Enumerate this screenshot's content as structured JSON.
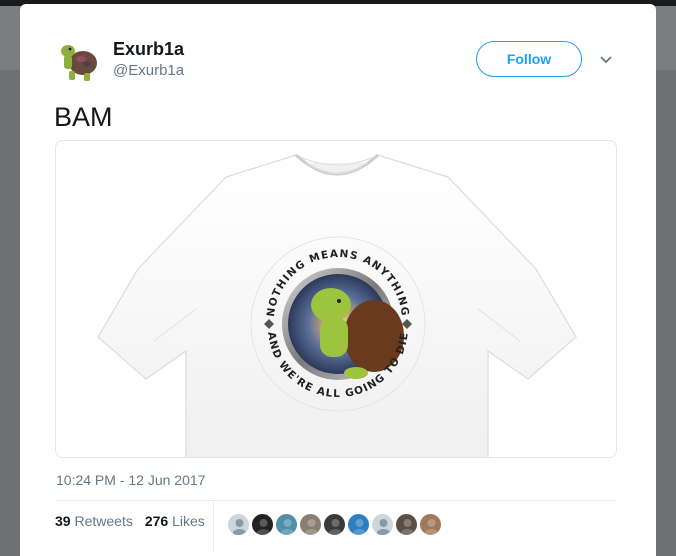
{
  "user": {
    "display_name": "Exurb1a",
    "screen_name": "@Exurb1a",
    "follow_label": "Follow"
  },
  "tweet": {
    "text": "BAM",
    "timestamp": "10:24 PM - 12 Jun 2017",
    "image": {
      "top_text": "NOTHING MEANS ANYTHING",
      "bottom_text": "AND WE'RE ALL GOING TO DIE"
    }
  },
  "stats": {
    "retweets_count": "39",
    "retweets_label": "Retweets",
    "likes_count": "276",
    "likes_label": "Likes"
  },
  "likers": [
    {
      "icon": "default-avatar-icon",
      "color": "#9aa5b1"
    },
    {
      "icon": "avatar-dark-icon",
      "color": "#222222"
    },
    {
      "icon": "avatar-car-icon",
      "color": "#4f8fa8"
    },
    {
      "icon": "avatar-person-icon",
      "color": "#8b7d70"
    },
    {
      "icon": "avatar-dog-icon",
      "color": "#3a3a3a"
    },
    {
      "icon": "avatar-blue-icon",
      "color": "#2e7fbf"
    },
    {
      "icon": "default-avatar-icon",
      "color": "#9aa5b1"
    },
    {
      "icon": "avatar-animal-icon",
      "color": "#5b4f45"
    },
    {
      "icon": "avatar-face-icon",
      "color": "#a0785a"
    }
  ],
  "colors": {
    "accent": "#1da1f2",
    "secondary_text": "#657786",
    "primary_text": "#14171a"
  }
}
